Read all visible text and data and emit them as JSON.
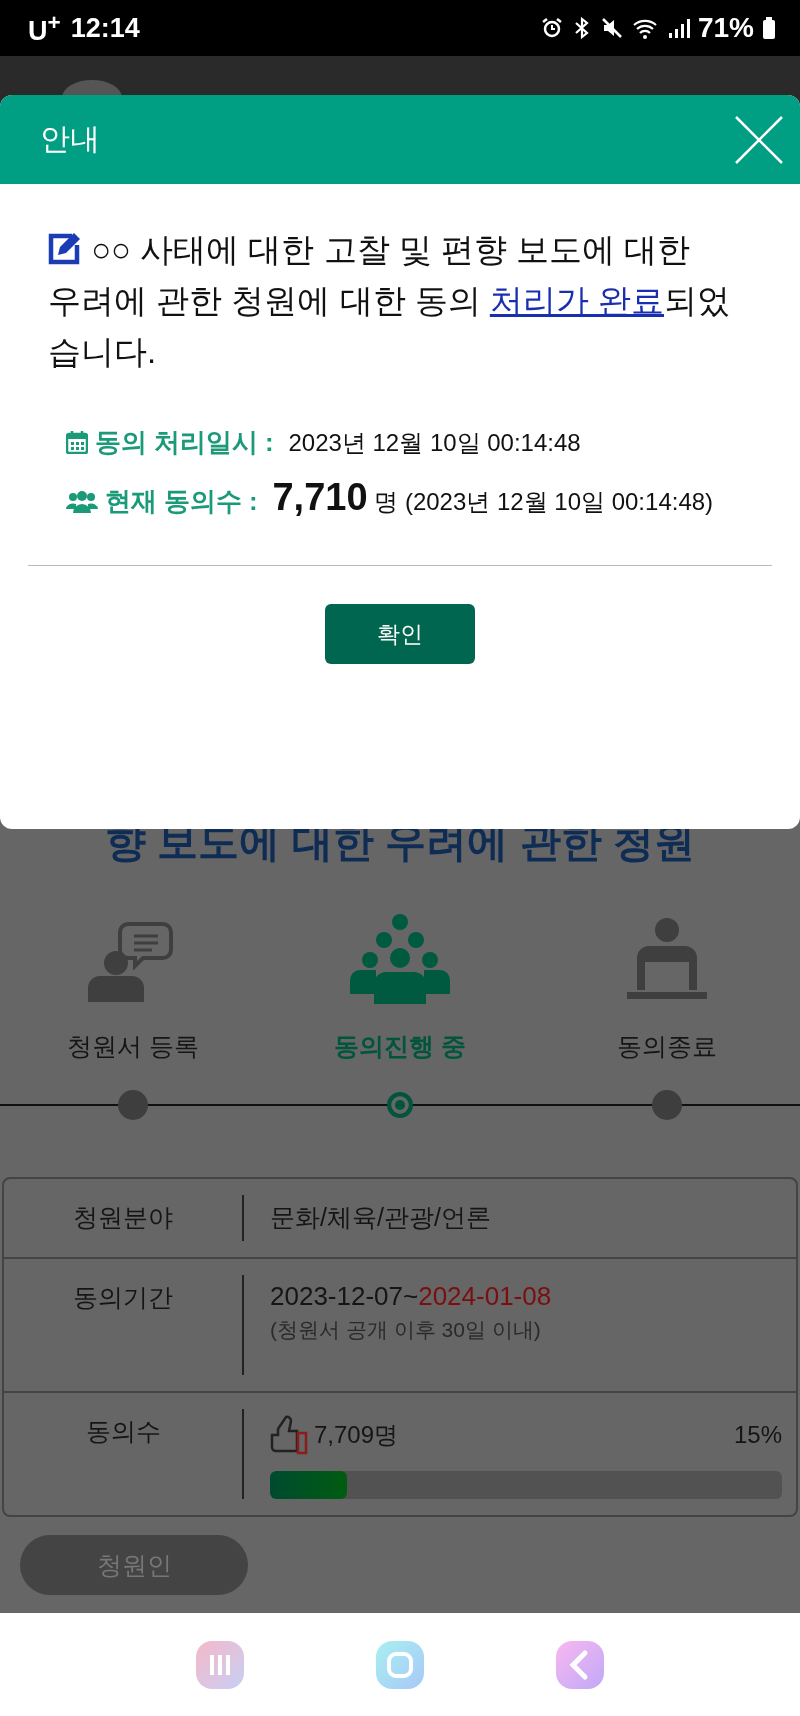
{
  "status_bar": {
    "carrier": "U$^{+}$",
    "time": "12:14",
    "battery": "71%"
  },
  "dialog": {
    "title": "안내",
    "message": {
      "before": "○○ 사태에 대한 고찰 및 편향 보도에 대한 우려에 관한 청원에 대한 동의 ",
      "link": "처리가 완료",
      "after": "되었습니다."
    },
    "info": [
      {
        "kind": "date",
        "label": "동의 처리일시 :",
        "value": "2023년 12월 10일 00:14:48"
      },
      {
        "kind": "count",
        "label": "현재 동의수 :",
        "count": "7,710",
        "value": "명 (2023년 12월 10일 00:14:48)"
      }
    ],
    "confirm": "확인"
  },
  "page": {
    "title": "향 보도에 대한 우려에 관한 청원",
    "steps": [
      {
        "kind": "register",
        "label": "청원서 등록",
        "selected": false
      },
      {
        "kind": "agree",
        "label": "동의진행 중",
        "selected": true
      },
      {
        "kind": "end",
        "label": "동의종료",
        "selected": false
      }
    ],
    "table": {
      "field": {
        "label": "청원분야",
        "value": "문화/체육/관광/언론"
      },
      "period": {
        "label": "동의기간",
        "start": "2023-12-07~",
        "end": "2024-01-08",
        "note": "(청원서 공개 이후 30일 이내)"
      },
      "count": {
        "label": "동의수",
        "value": "7,709명",
        "percent": "15%",
        "level": 0.15
      }
    },
    "petitioner_button": "청원인"
  }
}
